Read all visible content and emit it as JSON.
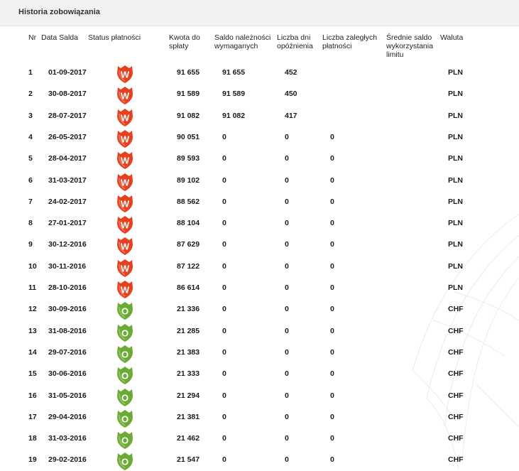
{
  "panel": {
    "title": "Historia zobowiązania"
  },
  "columns": {
    "nr": "Nr",
    "date": "Data Salda",
    "status": "Status płatności",
    "amount": "Kwota do spłaty",
    "due_balance": "Saldo należności wymaganych",
    "days_late": "Liczba dni opóźnienia",
    "overdue_count": "Liczba zaległych płatności",
    "avg_usage": "Średnie saldo wykorzystania limitu",
    "currency": "Waluta"
  },
  "status_badges": {
    "W": {
      "letter": "W",
      "icon": "red-shield-w-icon",
      "color": "#e8401f"
    },
    "O": {
      "letter": "O",
      "icon": "green-shield-o-icon",
      "color": "#6cab33"
    }
  },
  "rows": [
    {
      "nr": "1",
      "date": "01-09-2017",
      "status": "W",
      "amount": "91 655",
      "due_balance": "91 655",
      "days_late": "452",
      "overdue_count": "",
      "avg_usage": "",
      "currency": "PLN"
    },
    {
      "nr": "2",
      "date": "30-08-2017",
      "status": "W",
      "amount": "91 589",
      "due_balance": "91 589",
      "days_late": "450",
      "overdue_count": "",
      "avg_usage": "",
      "currency": "PLN"
    },
    {
      "nr": "3",
      "date": "28-07-2017",
      "status": "W",
      "amount": "91 082",
      "due_balance": "91 082",
      "days_late": "417",
      "overdue_count": "",
      "avg_usage": "",
      "currency": "PLN"
    },
    {
      "nr": "4",
      "date": "26-05-2017",
      "status": "W",
      "amount": "90 051",
      "due_balance": "0",
      "days_late": "0",
      "overdue_count": "0",
      "avg_usage": "",
      "currency": "PLN"
    },
    {
      "nr": "5",
      "date": "28-04-2017",
      "status": "W",
      "amount": "89 593",
      "due_balance": "0",
      "days_late": "0",
      "overdue_count": "0",
      "avg_usage": "",
      "currency": "PLN"
    },
    {
      "nr": "6",
      "date": "31-03-2017",
      "status": "W",
      "amount": "89 102",
      "due_balance": "0",
      "days_late": "0",
      "overdue_count": "0",
      "avg_usage": "",
      "currency": "PLN"
    },
    {
      "nr": "7",
      "date": "24-02-2017",
      "status": "W",
      "amount": "88 562",
      "due_balance": "0",
      "days_late": "0",
      "overdue_count": "0",
      "avg_usage": "",
      "currency": "PLN"
    },
    {
      "nr": "8",
      "date": "27-01-2017",
      "status": "W",
      "amount": "88 104",
      "due_balance": "0",
      "days_late": "0",
      "overdue_count": "0",
      "avg_usage": "",
      "currency": "PLN"
    },
    {
      "nr": "9",
      "date": "30-12-2016",
      "status": "W",
      "amount": "87 629",
      "due_balance": "0",
      "days_late": "0",
      "overdue_count": "0",
      "avg_usage": "",
      "currency": "PLN"
    },
    {
      "nr": "10",
      "date": "30-11-2016",
      "status": "W",
      "amount": "87 122",
      "due_balance": "0",
      "days_late": "0",
      "overdue_count": "0",
      "avg_usage": "",
      "currency": "PLN"
    },
    {
      "nr": "11",
      "date": "28-10-2016",
      "status": "W",
      "amount": "86 614",
      "due_balance": "0",
      "days_late": "0",
      "overdue_count": "0",
      "avg_usage": "",
      "currency": "PLN"
    },
    {
      "nr": "12",
      "date": "30-09-2016",
      "status": "O",
      "amount": "21 336",
      "due_balance": "0",
      "days_late": "0",
      "overdue_count": "0",
      "avg_usage": "",
      "currency": "CHF"
    },
    {
      "nr": "13",
      "date": "31-08-2016",
      "status": "O",
      "amount": "21 285",
      "due_balance": "0",
      "days_late": "0",
      "overdue_count": "0",
      "avg_usage": "",
      "currency": "CHF"
    },
    {
      "nr": "14",
      "date": "29-07-2016",
      "status": "O",
      "amount": "21 383",
      "due_balance": "0",
      "days_late": "0",
      "overdue_count": "0",
      "avg_usage": "",
      "currency": "CHF"
    },
    {
      "nr": "15",
      "date": "30-06-2016",
      "status": "O",
      "amount": "21 333",
      "due_balance": "0",
      "days_late": "0",
      "overdue_count": "0",
      "avg_usage": "",
      "currency": "CHF"
    },
    {
      "nr": "16",
      "date": "31-05-2016",
      "status": "O",
      "amount": "21 294",
      "due_balance": "0",
      "days_late": "0",
      "overdue_count": "0",
      "avg_usage": "",
      "currency": "CHF"
    },
    {
      "nr": "17",
      "date": "29-04-2016",
      "status": "O",
      "amount": "21 381",
      "due_balance": "0",
      "days_late": "0",
      "overdue_count": "0",
      "avg_usage": "",
      "currency": "CHF"
    },
    {
      "nr": "18",
      "date": "31-03-2016",
      "status": "O",
      "amount": "21 462",
      "due_balance": "0",
      "days_late": "0",
      "overdue_count": "0",
      "avg_usage": "",
      "currency": "CHF"
    },
    {
      "nr": "19",
      "date": "29-02-2016",
      "status": "O",
      "amount": "21 547",
      "due_balance": "0",
      "days_late": "0",
      "overdue_count": "0",
      "avg_usage": "",
      "currency": "CHF"
    }
  ]
}
